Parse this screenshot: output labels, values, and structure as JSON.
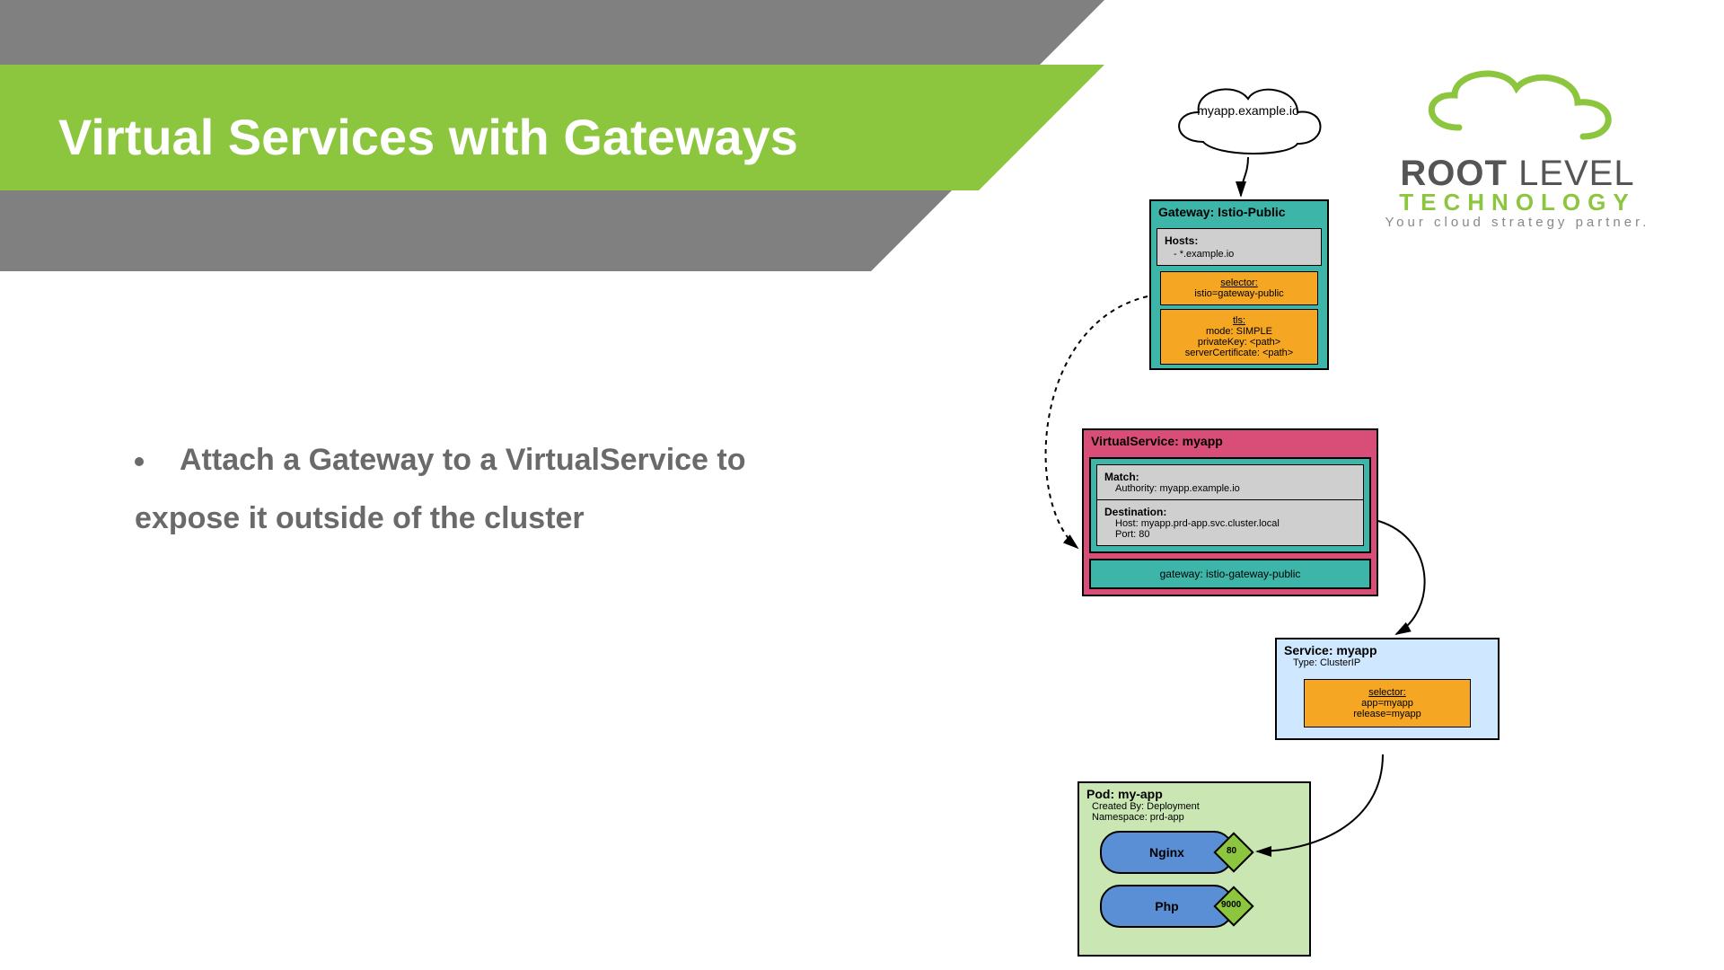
{
  "slide": {
    "title": "Virtual Services with Gateways",
    "bullet": "Attach a Gateway to a VirtualService to expose it outside of the cluster"
  },
  "logo": {
    "line1a": "ROOT",
    "line1b": "LEVEL",
    "line2": "TECHNOLOGY",
    "line3": "Your cloud strategy partner."
  },
  "diagram": {
    "cloud": {
      "label": "myapp.example.io"
    },
    "gateway": {
      "title": "Gateway: Istio-Public",
      "hosts_label": "Hosts:",
      "hosts_value": "- *.example.io",
      "selector_label": "selector:",
      "selector_value": "istio=gateway-public",
      "tls_label": "tls:",
      "tls_mode": "mode: SIMPLE",
      "tls_key": "privateKey: <path>",
      "tls_cert": "serverCertificate: <path>"
    },
    "virtualservice": {
      "title": "VirtualService: myapp",
      "match_label": "Match:",
      "match_value": "Authority: myapp.example.io",
      "dest_label": "Destination:",
      "dest_host": "Host: myapp.prd-app.svc.cluster.local",
      "dest_port": "Port: 80",
      "gateway": "gateway: istio-gateway-public"
    },
    "service": {
      "title": "Service: myapp",
      "type": "Type: ClusterIP",
      "selector_label": "selector:",
      "selector_app": "app=myapp",
      "selector_release": "release=myapp"
    },
    "pod": {
      "title": "Pod: my-app",
      "created": "Created By: Deployment",
      "namespace": "Namespace: prd-app",
      "container1": "Nginx",
      "port1": "80",
      "container2": "Php",
      "port2": "9000"
    }
  }
}
